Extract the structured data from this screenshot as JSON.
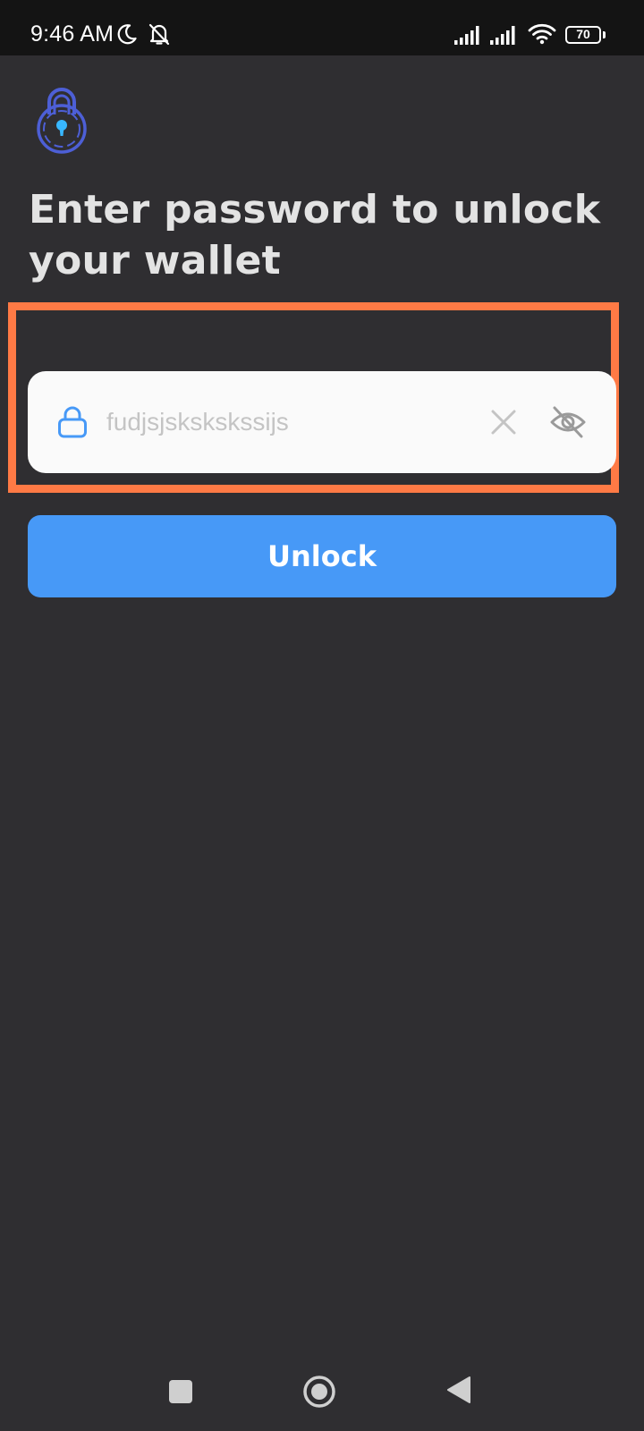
{
  "status_bar": {
    "time": "9:46 AM",
    "battery": "70",
    "icons": [
      "moon-icon",
      "bell-off-icon",
      "signal-icon",
      "signal-icon",
      "wifi-icon",
      "battery-icon"
    ]
  },
  "app": {
    "logo_icon": "padlock-logo-icon",
    "accent_color": "#4799f7",
    "highlight_color": "#ff7a45"
  },
  "page": {
    "title": "Enter password to unlock your wallet"
  },
  "password_field": {
    "value": "fudjsjskskskssijs",
    "icons": [
      "lock-icon",
      "clear-icon",
      "eye-off-icon"
    ]
  },
  "unlock_button": {
    "label": "Unlock"
  },
  "nav_bar": {
    "icons": [
      "recents-icon",
      "home-icon",
      "back-icon"
    ]
  }
}
